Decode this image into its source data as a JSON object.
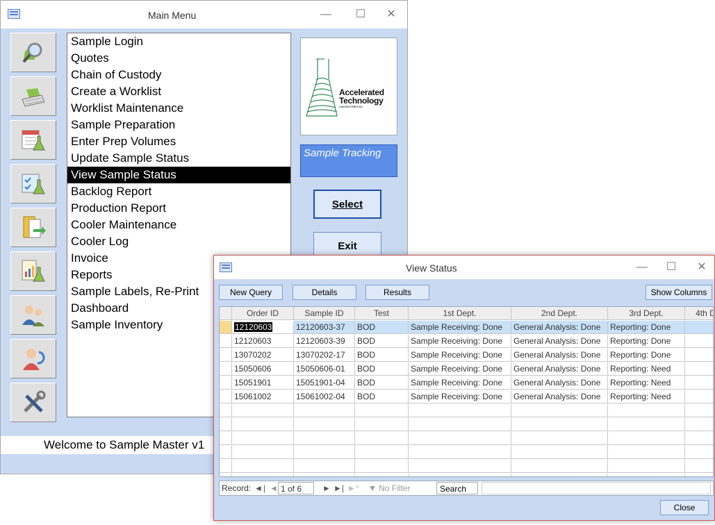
{
  "main_window": {
    "title": "Main Menu",
    "menu_items": [
      "Sample Login",
      "Quotes",
      "Chain of Custody",
      "Create a Worklist",
      "Worklist Maintenance",
      "Sample Preparation",
      "Enter Prep Volumes",
      "Update Sample Status",
      "View Sample Status",
      "Backlog Report",
      "Production Report",
      "Cooler Maintenance",
      "Cooler Log",
      "Invoice",
      "Reports",
      "Sample Labels, Re-Print",
      "Dashboard",
      "Sample Inventory"
    ],
    "selected_index": 8,
    "logo_text": [
      "Accelerated",
      "Technology",
      "LABORATORIES INC."
    ],
    "module_label": "Sample Tracking",
    "select_label": "Select",
    "exit_label": "Exit",
    "welcome_text": "Welcome to Sample Master v1",
    "side_icons": [
      "search-icon",
      "keyboard-icon",
      "calendar-flask-icon",
      "checklist-flask-icon",
      "binder-export-icon",
      "report-flask-icon",
      "users-icon",
      "user-refresh-icon",
      "tools-icon"
    ]
  },
  "view_status": {
    "title": "View Status",
    "toolbar": {
      "new_query": "New Query",
      "details": "Details",
      "results": "Results",
      "show_columns": "Show Columns"
    },
    "columns": [
      "Order ID",
      "Sample ID",
      "Test",
      "1st Dept.",
      "2nd Dept.",
      "3rd Dept.",
      "4th D"
    ],
    "rows": [
      [
        "12120603",
        "12120603-37",
        "BOD",
        "Sample Receiving: Done",
        "General Analysis: Done",
        "Reporting: Done",
        ""
      ],
      [
        "12120603",
        "12120603-39",
        "BOD",
        "Sample Receiving: Done",
        "General Analysis: Done",
        "Reporting: Done",
        ""
      ],
      [
        "13070202",
        "13070202-17",
        "BOD",
        "Sample Receiving: Done",
        "General Analysis: Done",
        "Reporting: Done",
        ""
      ],
      [
        "15050606",
        "15050606-01",
        "BOD",
        "Sample Receiving: Done",
        "General Analysis: Done",
        "Reporting: Need",
        ""
      ],
      [
        "15051901",
        "15051901-04",
        "BOD",
        "Sample Receiving: Done",
        "General Analysis: Done",
        "Reporting: Need",
        ""
      ],
      [
        "15061002",
        "15061002-04",
        "BOD",
        "Sample Receiving: Done",
        "General Analysis: Done",
        "Reporting: Need",
        ""
      ]
    ],
    "nav": {
      "record_label": "Record:",
      "position": "1 of 6",
      "filter_label": "No Filter",
      "search_placeholder": "Search"
    },
    "close_label": "Close"
  }
}
